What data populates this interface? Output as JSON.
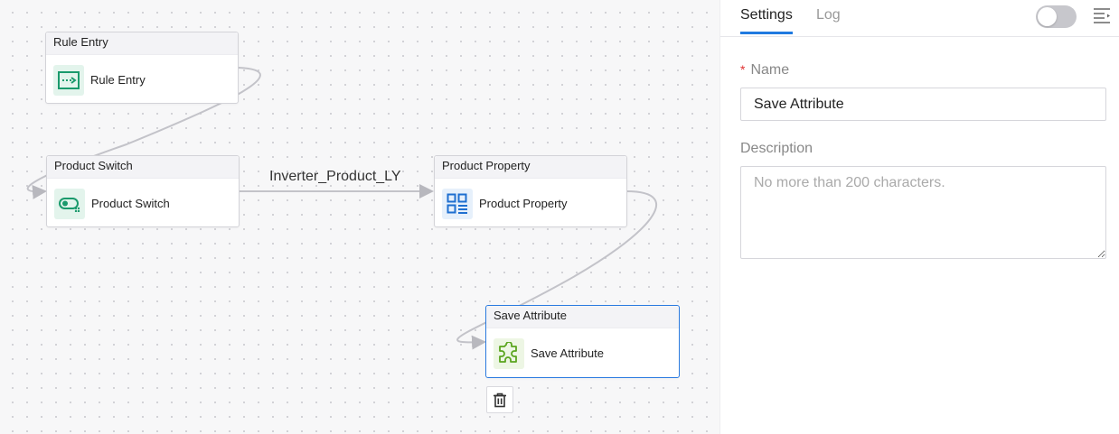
{
  "canvas": {
    "nodes": [
      {
        "id": "rule-entry",
        "title": "Rule Entry",
        "label": "Rule Entry",
        "icon": "rule-entry-icon"
      },
      {
        "id": "product-switch",
        "title": "Product Switch",
        "label": "Product Switch",
        "icon": "switch-icon"
      },
      {
        "id": "product-property",
        "title": "Product Property",
        "label": "Product Property",
        "icon": "property-grid-icon"
      },
      {
        "id": "save-attribute",
        "title": "Save Attribute",
        "label": "Save Attribute",
        "icon": "puzzle-icon",
        "selected": true
      }
    ],
    "edge_label": "Inverter_Product_LY",
    "trash_icon": "trash-icon"
  },
  "panel": {
    "tabs": [
      {
        "label": "Settings",
        "active": true
      },
      {
        "label": "Log",
        "active": false
      }
    ],
    "toggle_on": false,
    "name_label": "Name",
    "name_required_mark": "*",
    "name_value": "Save Attribute",
    "description_label": "Description",
    "description_placeholder": "No more than 200 characters.",
    "description_value": ""
  },
  "colors": {
    "accent": "#1f7ae0",
    "node_icon_green": "#1a9a6c",
    "node_icon_blue": "#1e6fd0",
    "puzzle_green": "#5aa51e"
  }
}
